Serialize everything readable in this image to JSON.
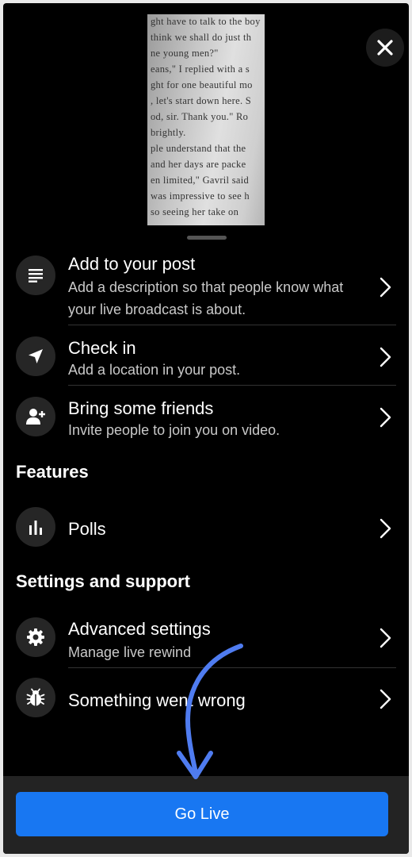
{
  "preview": {
    "lines": [
      "ght have to talk to the boy",
      "think we shall do just th",
      "ne young men?\"",
      "eans,\" I replied with a s",
      "ght for one beautiful mo",
      ", let's start down here. S",
      "od, sir. Thank you.\" Ro",
      "brightly.",
      "ple understand that the",
      "and her days are packe",
      "en limited,\" Gavril said",
      "was impressive to see h",
      "so seeing her take on"
    ]
  },
  "close_icon": "close-icon",
  "post_items": [
    {
      "title": "Add to your post",
      "subtitle": "Add a description so that people know what your live broadcast is about.",
      "icon": "text-lines-icon"
    },
    {
      "title": "Check in",
      "subtitle": "Add a location in your post.",
      "icon": "location-arrow-icon"
    },
    {
      "title": "Bring some friends",
      "subtitle": "Invite people to join you on video.",
      "icon": "add-friend-icon"
    }
  ],
  "features": {
    "heading": "Features",
    "items": [
      {
        "title": "Polls",
        "icon": "poll-bars-icon"
      }
    ]
  },
  "settings": {
    "heading": "Settings and support",
    "items": [
      {
        "title": "Advanced settings",
        "subtitle": "Manage live rewind",
        "icon": "gear-icon"
      },
      {
        "title": "Something went wrong",
        "icon": "bug-icon"
      }
    ]
  },
  "go_live_label": "Go Live",
  "colors": {
    "accent": "#1877f2",
    "annotation_arrow": "#4f7cf0",
    "background": "#000000"
  }
}
